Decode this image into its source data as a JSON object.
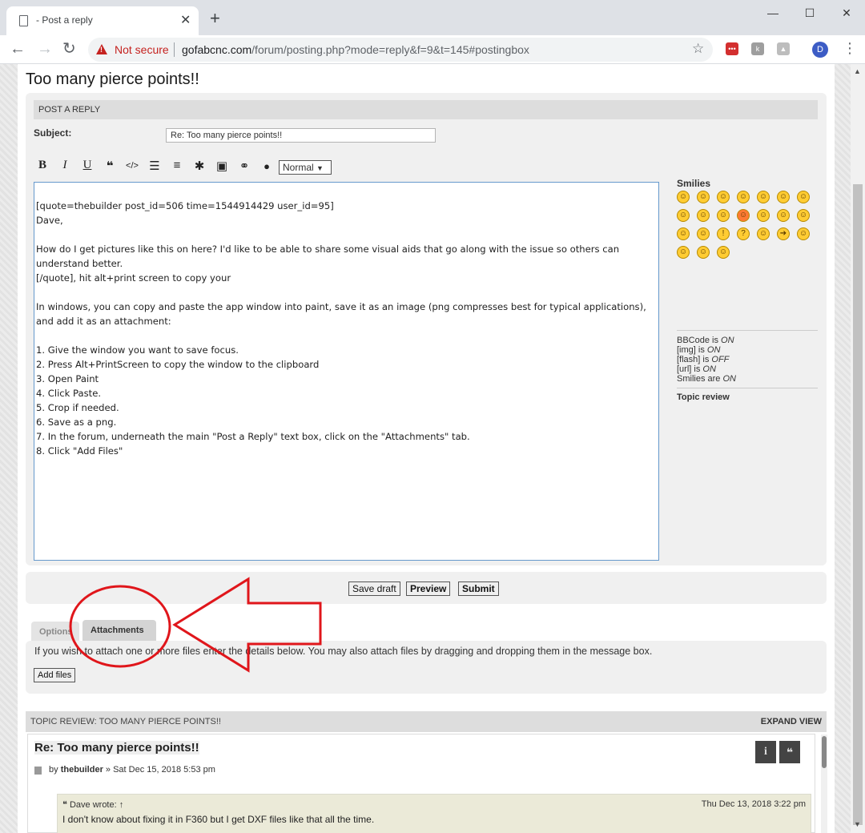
{
  "browser": {
    "tab_title": "- Post a reply",
    "security_label": "Not secure",
    "url_host": "gofabcnc.com",
    "url_path": "/forum/posting.php?mode=reply&f=9&t=145#postingbox",
    "profile_initial": "D"
  },
  "page": {
    "topic_title": "Too many pierce points!!",
    "panel_header": "POST A REPLY",
    "subject_label": "Subject:",
    "subject_value": "Re: Too many pierce points!!",
    "font_size_select": "Normal"
  },
  "toolbar": {
    "bold": "B",
    "italic": "I",
    "underline": "U",
    "quote": "❝",
    "code": "</>",
    "list": "☰",
    "list_numbered": "≡",
    "list_item": "✱",
    "image": "▣",
    "link": "⚭",
    "color": "●"
  },
  "editor_lines": [
    "[quote=thebuilder post_id=506 time=1544914429 user_id=95]",
    "Dave,",
    "",
    "How do I get pictures like this on here? I'd like to be able to share some visual aids that go along with the issue so others can",
    "understand better.",
    "[/quote], hit alt+print screen to copy your",
    "",
    "In windows, you can copy and paste the app window into paint, save it as an image (png compresses best for typical applications),",
    "and add it as an attachment:",
    "",
    "1. Give the window you want to save focus.",
    "2. Press Alt+PrintScreen to copy the window to the clipboard",
    "3. Open Paint",
    "4. Click Paste.",
    "5. Crop if needed.",
    "6. Save as a png.",
    "7. In the forum, underneath the main \"Post a Reply\" text box, click on the \"Attachments\" tab.",
    "8. Click \"Add Files\""
  ],
  "sidebar": {
    "smilies_title": "Smilies",
    "bbcode_prefix": "BBCode is ",
    "bbcode_state": "ON",
    "img_prefix": "[img] is ",
    "img_state": "ON",
    "flash_prefix": "[flash] is ",
    "flash_state": "OFF",
    "url_prefix": "[url] is ",
    "url_state": "ON",
    "smilies_prefix": "Smilies are ",
    "smilies_state": "ON",
    "topic_review": "Topic review"
  },
  "buttons": {
    "save_draft": "Save draft",
    "preview": "Preview",
    "submit": "Submit"
  },
  "tabs": {
    "options": "Options",
    "attachments": "Attachments"
  },
  "attachments": {
    "help_text": "If you wish to attach one or more files enter the details below. You may also attach files by dragging and dropping them in the message box.",
    "add_files": "Add files"
  },
  "review": {
    "header": "TOPIC REVIEW: TOO MANY PIERCE POINTS!!",
    "expand": "EXPAND VIEW",
    "post_title": "Re: Too many pierce points!!",
    "by": "by ",
    "author": "thebuilder",
    "date": " » Sat Dec 15, 2018 5:53 pm",
    "info_btn": "i",
    "quote_btn": "❝",
    "quote_author": "❝ Dave wrote: ↑",
    "quote_date": "Thu Dec 13, 2018 3:22 pm",
    "quote_text": "I don't know about fixing it in F360 but I get DXF files like that all the time."
  },
  "colors": {
    "annotation_red": "#e0161b",
    "editor_border": "#6699cc",
    "panel_bg": "#f0f0f0"
  }
}
